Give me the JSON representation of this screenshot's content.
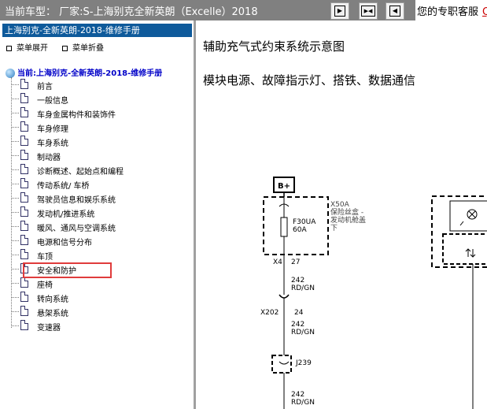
{
  "topbar": {
    "title": "当前车型： 厂家:S-上海别克全新英朗（Excelle）2018",
    "buttons": [
      {
        "name": "nav-first-button",
        "glyph": "▶"
      },
      {
        "name": "nav-toggle-button",
        "glyph": "◀▶"
      },
      {
        "name": "nav-last-button",
        "glyph": "◀"
      }
    ],
    "service_text": "您的专职客服",
    "service_link": "Q"
  },
  "sidebar": {
    "book_title": "上海别克-全新英朗-2018-维修手册",
    "expand_label": "菜单展开",
    "collapse_label": "菜单折叠",
    "current_label": "当前:上海别克-全新英朗-2018-维修手册",
    "items": [
      {
        "label": "前言"
      },
      {
        "label": "一般信息"
      },
      {
        "label": "车身金属构件和装饰件"
      },
      {
        "label": "车身修理"
      },
      {
        "label": "车身系统"
      },
      {
        "label": "制动器"
      },
      {
        "label": "诊断概述、起始点和编程"
      },
      {
        "label": "传动系统/ 车桥"
      },
      {
        "label": "驾驶员信息和娱乐系统"
      },
      {
        "label": "发动机/推进系统"
      },
      {
        "label": "暖风、通风与空调系统"
      },
      {
        "label": "电源和信号分布"
      },
      {
        "label": "车顶"
      },
      {
        "label": "安全和防护"
      },
      {
        "label": "座椅"
      },
      {
        "label": "转向系统"
      },
      {
        "label": "悬架系统"
      },
      {
        "label": "变速器"
      }
    ],
    "highlight_color": "#e03c3c"
  },
  "content": {
    "title": "辅助充气式约束系统示意图",
    "subtitle": "模块电源、故障指示灯、搭铁、数据通信",
    "diagram": {
      "power_label": "B+",
      "fuse_name": "F30UA",
      "fuse_rating": "60A",
      "fusebox_id": "X50A",
      "fusebox_desc1": "保险丝盒 -",
      "fusebox_desc2": "发动机舱盖",
      "fusebox_desc3": "下",
      "conn1_name": "X4",
      "conn1_pin": "27",
      "wire1_gauge": "242",
      "wire1_color": "RD/GN",
      "conn2_name": "X202",
      "conn2_pin": "24",
      "wire2_gauge": "242",
      "wire2_color": "RD/GN",
      "splice_name": "J239",
      "wire3_gauge": "242",
      "wire3_color": "RD/GN"
    }
  },
  "colors": {
    "topbar_bg": "#808080",
    "book_header_bg": "#0e5a9b",
    "tree_root_text": "#0000c8"
  }
}
